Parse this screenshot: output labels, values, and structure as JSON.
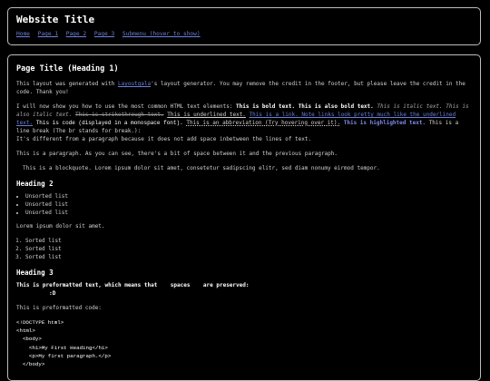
{
  "header": {
    "title": "Website Title",
    "nav": [
      "Home",
      "Page 1",
      "Page 2",
      "Page 3",
      "Submenu (hover to show)"
    ]
  },
  "main": {
    "h1": "Page Title (Heading 1)",
    "intro": {
      "before": "This layout was generated with ",
      "link": "Layoutgala",
      "after": "'s layout generator. You may remove the credit in the footer, but please leave the credit in the code. Thank you!"
    },
    "elements": {
      "lead": "I will now show you how to use the most common HTML text elements: ",
      "bold": "This is bold text.",
      "also_bold": "This is also bold text.",
      "italic": "This is italic text.",
      "also_italic": "This is also italic text.",
      "strike": "This is strikethrough text.",
      "underline": "This is underlined text.",
      "linklike": "This is a link. Note links look pretty much like the underlined text.",
      "code": "This is code (displayed in a monospace font).",
      "abbr": "This is an abbreviation (Try hovering over it).",
      "highlight": "This is highlighted text.",
      "linebreak": "This is a line break (The br stands for break.):",
      "after_break": "It's different from a paragraph because it does not add space inbetween the lines of text."
    },
    "paragraph": "This is a paragraph. As you can see, there's a bit of space between it and the previous paragraph.",
    "blockquote": "This is a blockquote. Lorem ipsum dolor sit amet, consetetur sadipscing elitr, sed diam nonumy eirmod tempor.",
    "h2": "Heading 2",
    "unsorted": [
      "Unsorted list",
      "Unsorted list",
      "Unsorted list"
    ],
    "lorem": "Lorem ipsum dolor sit amet.",
    "sorted": [
      "Sorted list",
      "Sorted list",
      "Sorted list"
    ],
    "h3": "Heading 3",
    "preformatted": "This is preformatted text, which means that    spaces    are preserved:\n          :D",
    "pre_label": "This is preformatted code:",
    "code_block": "<!DOCTYPE html>\n<html>\n  <body>\n    <h1>My First Heading</h1>\n    <p>My first paragraph.</p>\n  </body>"
  }
}
